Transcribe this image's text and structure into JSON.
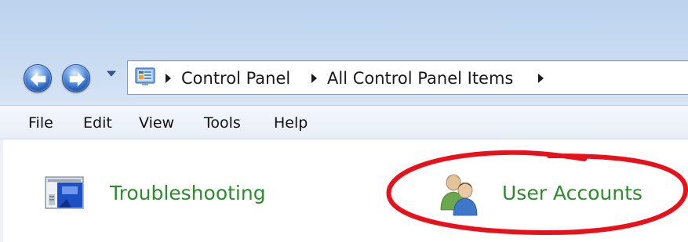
{
  "breadcrumb": {
    "items": [
      "Control Panel",
      "All Control Panel Items"
    ]
  },
  "menu": {
    "items": [
      "File",
      "Edit",
      "View",
      "Tools",
      "Help"
    ]
  },
  "content": {
    "items": [
      {
        "label": "Troubleshooting",
        "icon": "troubleshooting-icon"
      },
      {
        "label": "User Accounts",
        "icon": "user-accounts-icon"
      }
    ]
  },
  "icons": {
    "back": "back-arrow-icon",
    "forward": "forward-arrow-icon",
    "recent_pages": "dropdown-arrow-icon",
    "address": "control-panel-icon"
  },
  "colors": {
    "link_green": "#2e8b2e",
    "annotation_red": "#e8101a",
    "nav_blue": "#1f5cb8"
  }
}
